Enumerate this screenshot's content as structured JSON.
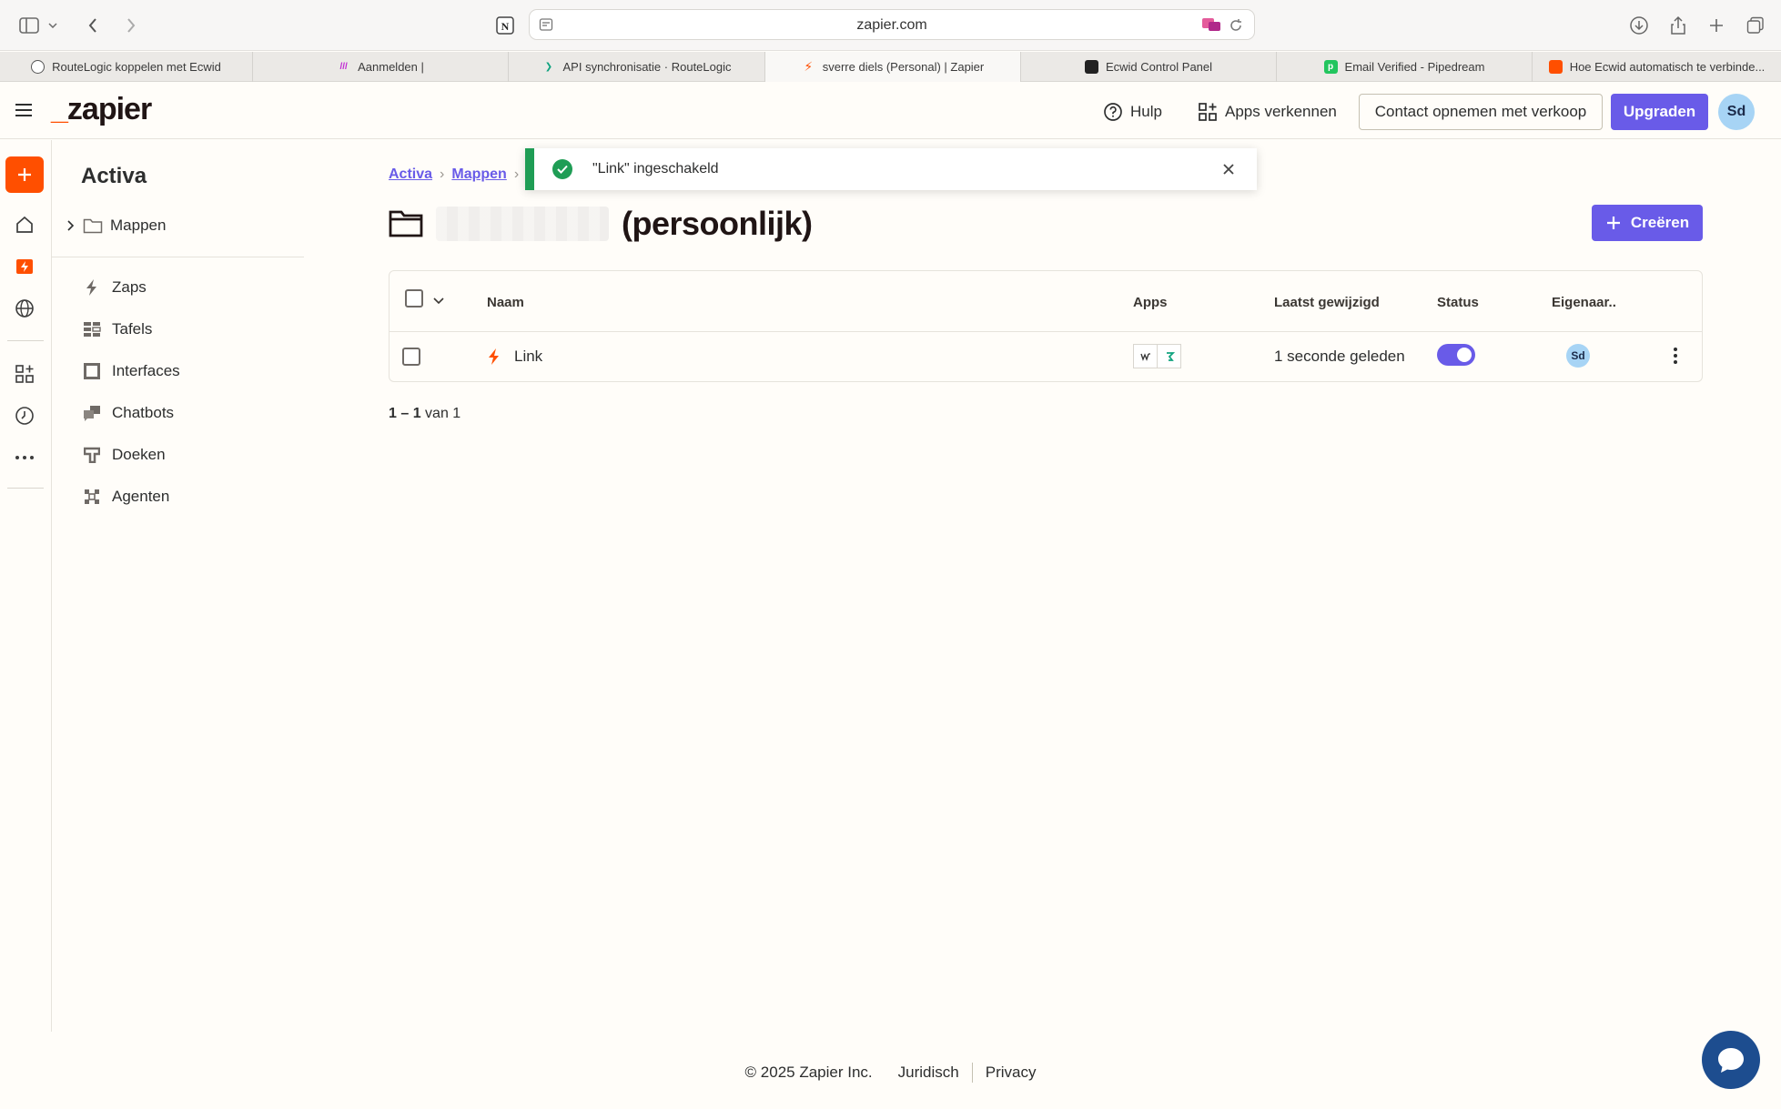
{
  "browser": {
    "url": "zapier.com",
    "tabs": [
      {
        "label": "RouteLogic koppelen met Ecwid"
      },
      {
        "label": "Aanmelden |"
      },
      {
        "label": "API synchronisatie · RouteLogic"
      },
      {
        "label": "sverre diels (Personal) | Zapier"
      },
      {
        "label": "Ecwid Control Panel"
      },
      {
        "label": "Email Verified - Pipedream"
      },
      {
        "label": "Hoe Ecwid automatisch te verbinde..."
      }
    ]
  },
  "header": {
    "logo": "zapier",
    "help_label": "Hulp",
    "explore_label": "Apps verkennen",
    "contact_label": "Contact opnemen met verkoop",
    "upgrade_label": "Upgraden",
    "avatar_initials": "Sd"
  },
  "sidebar": {
    "title": "Activa",
    "folder_label": "Mappen",
    "items": [
      {
        "label": "Zaps"
      },
      {
        "label": "Tafels"
      },
      {
        "label": "Interfaces"
      },
      {
        "label": "Chatbots"
      },
      {
        "label": "Doeken"
      },
      {
        "label": "Agenten"
      }
    ]
  },
  "breadcrumb": {
    "root": "Activa",
    "folders": "Mappen"
  },
  "page": {
    "title": "(persoonlijk)",
    "create_label": "Creëren"
  },
  "table": {
    "columns": {
      "name": "Naam",
      "apps": "Apps",
      "modified": "Laatst gewijzigd",
      "status": "Status",
      "owner": "Eigenaar.."
    },
    "rows": [
      {
        "name": "Link",
        "modified": "1 seconde geleden",
        "status_on": true,
        "owner_initials": "Sd"
      }
    ]
  },
  "pagination": {
    "range": "1 – 1",
    "suffix": "van 1"
  },
  "toast": {
    "message": "\"Link\" ingeschakeld"
  },
  "footer": {
    "copyright": "© 2025 Zapier Inc.",
    "legal": "Juridisch",
    "privacy": "Privacy"
  },
  "colors": {
    "accent": "#695be8",
    "brand": "#ff4f00",
    "success": "#1f9d55"
  }
}
